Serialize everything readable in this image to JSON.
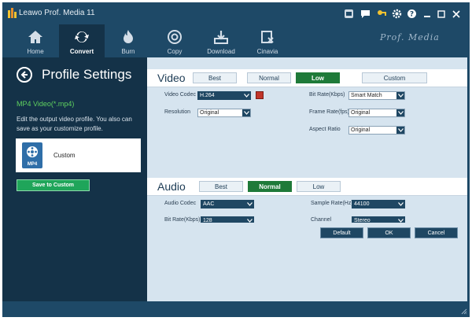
{
  "window": {
    "title": "Leawo Prof. Media 11",
    "brand": "Prof. Media"
  },
  "nav": {
    "items": [
      {
        "label": "Home",
        "icon": "home-icon"
      },
      {
        "label": "Convert",
        "icon": "convert-icon",
        "active": true
      },
      {
        "label": "Burn",
        "icon": "burn-icon"
      },
      {
        "label": "Copy",
        "icon": "copy-icon"
      },
      {
        "label": "Download",
        "icon": "download-icon"
      },
      {
        "label": "Cinavia",
        "icon": "cinavia-icon"
      }
    ]
  },
  "left_panel": {
    "title": "Profile Settings",
    "format": "MP4 Video(*.mp4)",
    "description": "Edit the output video profile. You also can save as your customize profile.",
    "custom_label": "Custom",
    "icon_text": "MP4",
    "save_button": "Save to Custom"
  },
  "video": {
    "title": "Video",
    "quality_buttons": [
      "Best",
      "Normal",
      "Low",
      "Custom"
    ],
    "selected": "Low",
    "labels": {
      "codec": "Video Codec",
      "resolution": "Resolution",
      "bitrate": "Bit Rate(Kbps)",
      "framerate": "Frame Rate(fps)",
      "aspect": "Aspect Ratio"
    },
    "values": {
      "codec": "H.264",
      "resolution": "Original",
      "bitrate": "Smart Match",
      "framerate": "Original",
      "aspect": "Original"
    }
  },
  "audio": {
    "title": "Audio",
    "quality_buttons": [
      "Best",
      "Normal",
      "Low"
    ],
    "selected": "Normal",
    "labels": {
      "codec": "Audio Codec",
      "bitrate": "Bit Rate(Kbps)",
      "samplerate": "Sample Rate(Hz)",
      "channel": "Channel"
    },
    "values": {
      "codec": "AAC",
      "bitrate": "128",
      "samplerate": "44100",
      "channel": "Stereo"
    }
  },
  "footer": {
    "default": "Default",
    "ok": "OK",
    "cancel": "Cancel"
  },
  "colors": {
    "accent_green": "#1f7a39",
    "frame_blue": "#1e4967",
    "panel_dark": "#143248"
  }
}
